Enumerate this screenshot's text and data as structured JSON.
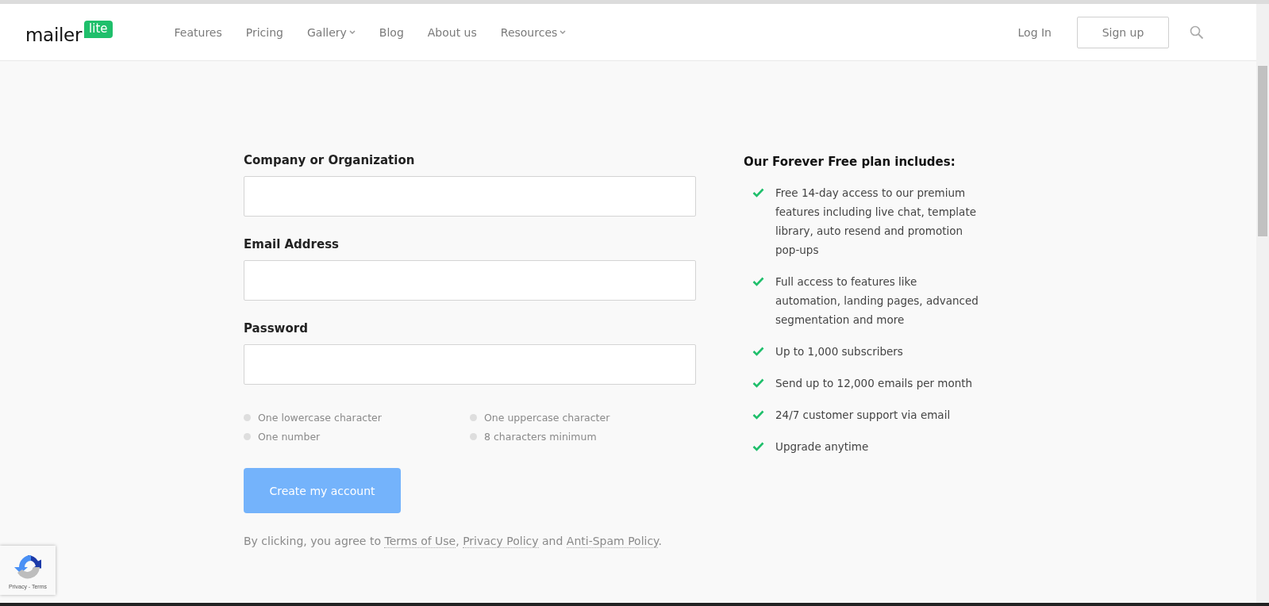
{
  "header": {
    "logo": {
      "word": "mailer",
      "badge": "lite"
    },
    "nav": [
      {
        "label": "Features",
        "dropdown": false
      },
      {
        "label": "Pricing",
        "dropdown": false
      },
      {
        "label": "Gallery",
        "dropdown": true
      },
      {
        "label": "Blog",
        "dropdown": false
      },
      {
        "label": "About us",
        "dropdown": false
      },
      {
        "label": "Resources",
        "dropdown": true
      }
    ],
    "login": "Log In",
    "signup": "Sign up"
  },
  "form": {
    "fields": [
      {
        "label": "Company or Organization"
      },
      {
        "label": "Email Address"
      },
      {
        "label": "Password"
      }
    ],
    "requirements": [
      {
        "text": "One lowercase character",
        "met": false
      },
      {
        "text": "One uppercase character",
        "met": false
      },
      {
        "text": "One number",
        "met": false
      },
      {
        "text": "8 characters minimum",
        "met": false
      }
    ],
    "submit": {
      "label": "Create my account",
      "disabled": true
    },
    "agreement": {
      "parts": [
        {
          "kind": "text",
          "text": "By clicking, you agree to"
        },
        {
          "kind": "link",
          "text": "Terms of Use"
        },
        {
          "kind": "text",
          "text": ","
        },
        {
          "kind": "link",
          "text": "Privacy Policy"
        },
        {
          "kind": "text",
          "text": "and"
        },
        {
          "kind": "link",
          "text": "Anti-Spam Policy"
        },
        {
          "kind": "text",
          "text": "."
        }
      ]
    }
  },
  "plan": {
    "title": "Our Forever Free plan includes:",
    "items": [
      "Free 14-day access to our premium features including live chat, template library, auto resend and promotion pop-ups",
      "Full access to features like automation, landing pages, advanced segmentation and more",
      "Up to 1,000 subscribers",
      "Send up to 12,000 emails per month",
      "24/7 customer support via email",
      "Upgrade anytime"
    ]
  },
  "recaptcha": {
    "links": "Privacy - Terms"
  }
}
